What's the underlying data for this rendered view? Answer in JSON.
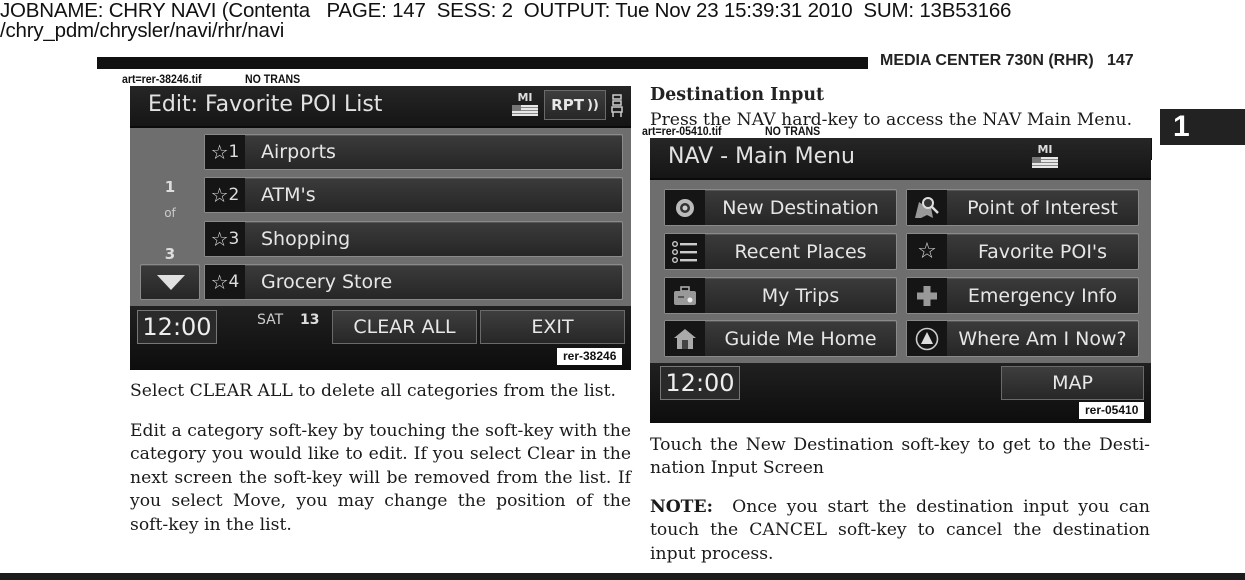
{
  "job_header": {
    "line1": "JOBNAME: CHRY NAVI (Contenta   PAGE: 147  SESS: 2  OUTPUT: Tue Nov 23 15:39:31 2010  SUM: 13B53166",
    "line2": "/chry_pdm/chrysler/navi/rhr/navi"
  },
  "running_head": {
    "title": "MEDIA CENTER 730N (RHR)",
    "page_number": "147"
  },
  "section_tab": "1",
  "left_figure": {
    "art_file": "art=rer-38246.tif",
    "trans_note": "NO TRANS",
    "art_id": "rer-38246",
    "screen": {
      "title": "Edit: Favorite POI List",
      "region_label": "MI",
      "rpt_button": "RPT",
      "page_indicator": {
        "current": "1",
        "of": "of",
        "total": "3"
      },
      "items": [
        {
          "number": "1",
          "label": "Airports",
          "icon": "star-icon"
        },
        {
          "number": "2",
          "label": "ATM's",
          "icon": "star-icon"
        },
        {
          "number": "3",
          "label": "Shopping",
          "icon": "star-icon"
        },
        {
          "number": "4",
          "label": "Grocery Store",
          "icon": "star-icon"
        }
      ],
      "scroll_down_icon": "triangle-down-icon",
      "clock": "12:00",
      "day": "SAT",
      "date": "13",
      "clear_all_button": "CLEAR ALL",
      "exit_button": "EXIT"
    }
  },
  "left_text": {
    "para1": "Select CLEAR ALL to delete all categories from the list.",
    "para2": "Edit a category soft-key by touching the soft-key with the category you would like to edit. If you select Clear in the next screen the soft-key will be removed from the list. If you select Move, you may change the position of the soft-key in the list."
  },
  "right_text": {
    "heading": "Destination Input",
    "intro": "Press the NAV hard-key to access the NAV Main Menu.",
    "para1": "Touch the New Destination soft-key to get to the Desti- nation Input Screen",
    "note_label": "NOTE:",
    "note_text": "Once you start the destination input you can touch the CANCEL soft-key to cancel the destination input process."
  },
  "right_figure": {
    "art_file": "art=rer-05410.tif",
    "trans_note": "NO TRANS",
    "art_id": "rer-05410",
    "screen": {
      "title": "NAV - Main Menu",
      "region_label": "MI",
      "menu": [
        {
          "label": "New Destination",
          "icon": "target-icon"
        },
        {
          "label": "Point of Interest",
          "icon": "map-search-icon"
        },
        {
          "label": "Recent Places",
          "icon": "list-icon"
        },
        {
          "label": "Favorite POI's",
          "icon": "star-icon"
        },
        {
          "label": "My Trips",
          "icon": "suitcase-icon"
        },
        {
          "label": "Emergency Info",
          "icon": "cross-icon"
        },
        {
          "label": "Guide Me Home",
          "icon": "home-icon"
        },
        {
          "label": "Where Am I Now?",
          "icon": "navigation-arrow-icon"
        }
      ],
      "clock": "12:00",
      "map_button": "MAP"
    }
  }
}
